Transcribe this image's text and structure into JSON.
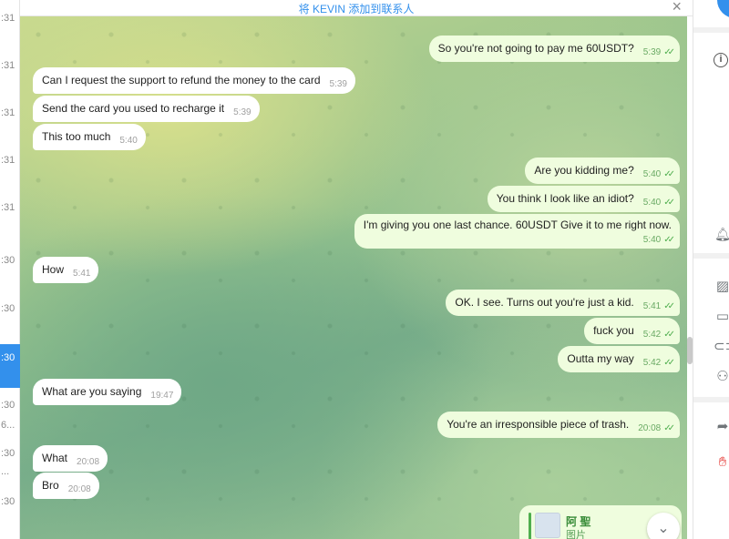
{
  "header": {
    "add_contact": "将 KEVIN 添加到联系人",
    "close": "×"
  },
  "chat_list_edge": {
    "times": [
      ":31",
      ":31",
      ":31",
      ":31",
      ":31",
      ":30",
      ":30",
      ":30",
      ":30",
      "6...",
      ":30",
      "...",
      ":30"
    ]
  },
  "messages": [
    {
      "side": "out",
      "text": "So you're not going to pay me 60USDT?",
      "time": "5:39"
    },
    {
      "side": "in",
      "text": "Can I request the support to refund the money to the card",
      "time": "5:39"
    },
    {
      "side": "in",
      "text": "Send the card you used to recharge it",
      "time": "5:39"
    },
    {
      "side": "in",
      "text": "This too much",
      "time": "5:40"
    },
    {
      "side": "out",
      "text": "Are you kidding me?",
      "time": "5:40"
    },
    {
      "side": "out",
      "text": "You think I look like an idiot?",
      "time": "5:40"
    },
    {
      "side": "out",
      "text": "I'm giving you one last chance. 60USDT Give it to me right now.",
      "time": "5:40"
    },
    {
      "side": "in",
      "text": "How",
      "time": "5:41"
    },
    {
      "side": "out",
      "text": "OK. I see. Turns out you're just a kid.",
      "time": "5:41"
    },
    {
      "side": "out",
      "text": "fuck you",
      "time": "5:42"
    },
    {
      "side": "out",
      "text": "Outta my way",
      "time": "5:42"
    },
    {
      "side": "in",
      "text": "What are you saying",
      "time": "19:47"
    },
    {
      "side": "out",
      "text": "You're an irresponsible piece of trash.",
      "time": "20:08"
    },
    {
      "side": "in",
      "text": "What",
      "time": "20:08"
    },
    {
      "side": "in",
      "text": "Bro",
      "time": "20:08"
    }
  ],
  "media_preview": {
    "sender": "阿 聖",
    "kind": "图片"
  },
  "read_receipt": "✓✓",
  "icons": {
    "info": "info-icon",
    "bell": "bell-icon",
    "stats": "statistics-icon",
    "video": "video-icon",
    "link": "link-icon",
    "members": "members-icon",
    "share": "share-icon",
    "hand": "hand-icon",
    "chevron": "chevron-down-icon"
  },
  "colors": {
    "accent": "#3390ec",
    "outgoing": "#effdde",
    "check": "#4fae4e",
    "warn": "#e53935"
  }
}
